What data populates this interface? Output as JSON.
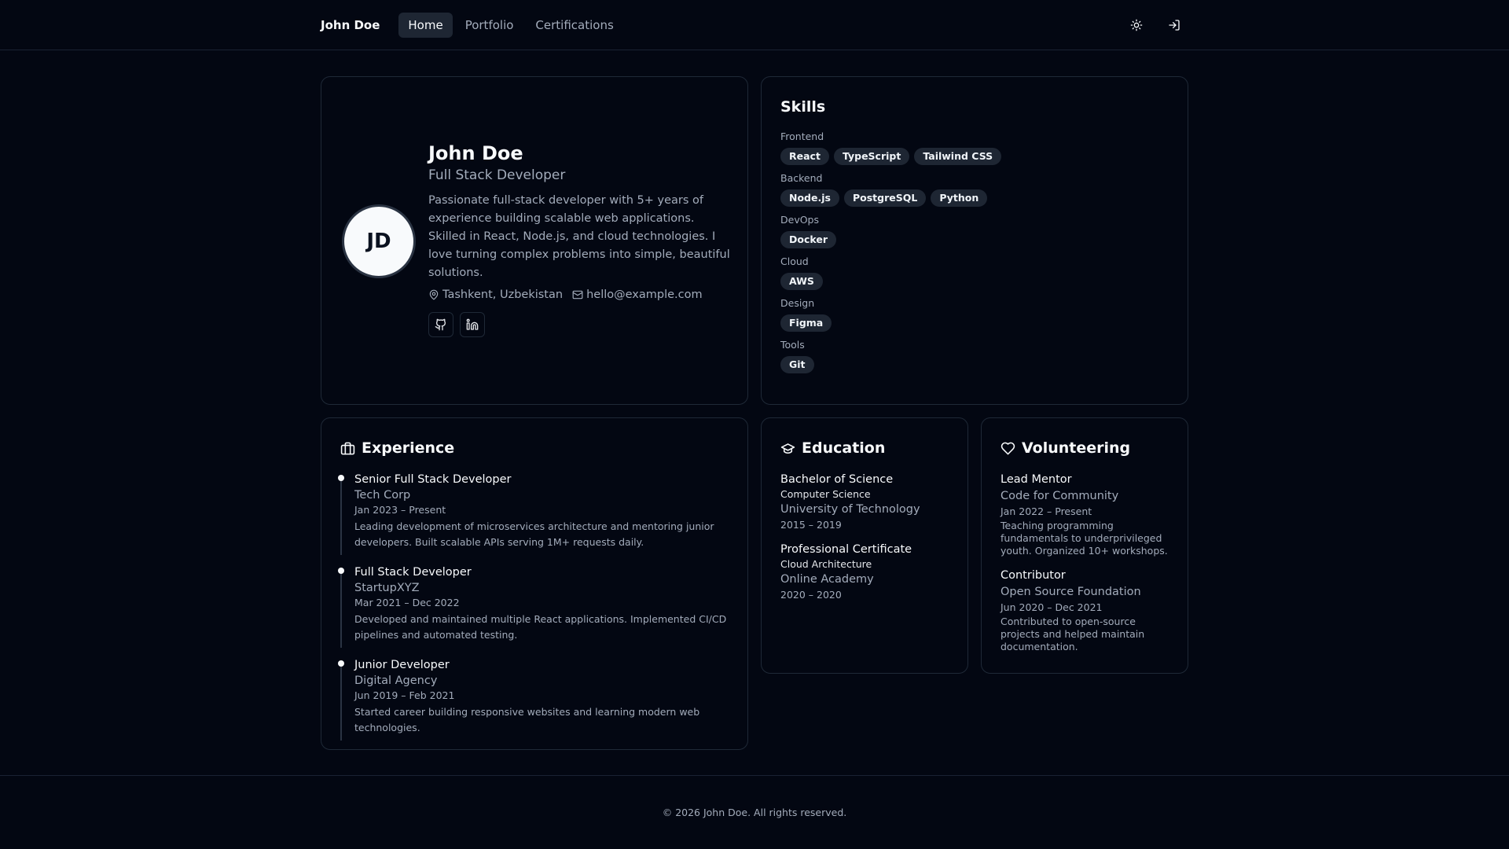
{
  "header": {
    "brand": "John Doe",
    "nav": [
      {
        "label": "Home",
        "active": true
      },
      {
        "label": "Portfolio",
        "active": false
      },
      {
        "label": "Certifications",
        "active": false
      }
    ],
    "theme_icon": "sun-icon",
    "login_icon": "log-in-icon"
  },
  "profile": {
    "initials": "JD",
    "name": "John Doe",
    "role": "Full Stack Developer",
    "bio": "Passionate full-stack developer with 5+ years of experience building scalable web applications. Skilled in React, Node.js, and cloud technologies. I love turning complex problems into simple, beautiful solutions.",
    "location": "Tashkent, Uzbekistan",
    "email": "hello@example.com",
    "socials": [
      "github-icon",
      "linkedin-icon"
    ]
  },
  "skills": {
    "title": "Skills",
    "groups": [
      {
        "label": "Frontend",
        "items": [
          "React",
          "TypeScript",
          "Tailwind CSS"
        ]
      },
      {
        "label": "Backend",
        "items": [
          "Node.js",
          "PostgreSQL",
          "Python"
        ]
      },
      {
        "label": "DevOps",
        "items": [
          "Docker"
        ]
      },
      {
        "label": "Cloud",
        "items": [
          "AWS"
        ]
      },
      {
        "label": "Design",
        "items": [
          "Figma"
        ]
      },
      {
        "label": "Tools",
        "items": [
          "Git"
        ]
      }
    ]
  },
  "experience": {
    "title": "Experience",
    "items": [
      {
        "title": "Senior Full Stack Developer",
        "company": "Tech Corp",
        "dates": "Jan 2023 – Present",
        "desc": "Leading development of microservices architecture and mentoring junior developers. Built scalable APIs serving 1M+ requests daily."
      },
      {
        "title": "Full Stack Developer",
        "company": "StartupXYZ",
        "dates": "Mar 2021 – Dec 2022",
        "desc": "Developed and maintained multiple React applications. Implemented CI/CD pipelines and automated testing."
      },
      {
        "title": "Junior Developer",
        "company": "Digital Agency",
        "dates": "Jun 2019 – Feb 2021",
        "desc": "Started career building responsive websites and learning modern web technologies."
      }
    ]
  },
  "education": {
    "title": "Education",
    "items": [
      {
        "title": "Bachelor of Science",
        "field": "Computer Science",
        "org": "University of Technology",
        "dates": "2015 – 2019"
      },
      {
        "title": "Professional Certificate",
        "field": "Cloud Architecture",
        "org": "Online Academy",
        "dates": "2020 – 2020"
      }
    ]
  },
  "volunteering": {
    "title": "Volunteering",
    "items": [
      {
        "title": "Lead Mentor",
        "org": "Code for Community",
        "dates": "Jan 2022 – Present",
        "desc": "Teaching programming fundamentals to underprivileged youth. Organized 10+ workshops."
      },
      {
        "title": "Contributor",
        "org": "Open Source Foundation",
        "dates": "Jun 2020 – Dec 2021",
        "desc": "Contributed to open-source projects and helped maintain documentation."
      }
    ]
  },
  "footer": {
    "text": "© 2026 John Doe. All rights reserved."
  }
}
